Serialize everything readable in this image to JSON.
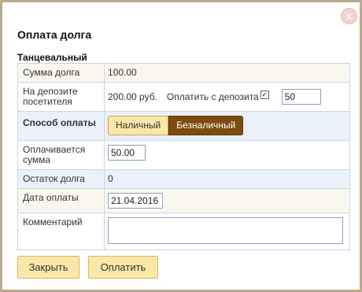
{
  "dialog": {
    "close_glyph": "x",
    "title": "Оплата долга",
    "subtitle": "Танцевальный"
  },
  "form": {
    "debt_amount": {
      "label": "Сумма долга",
      "value": "100.00"
    },
    "deposit": {
      "label": "На депозите посетителя",
      "value": "200.00 руб.",
      "pay_from_deposit_label": "Оплатить с депозита",
      "pay_from_deposit_checked": true,
      "deposit_amount": "50"
    },
    "payment_method": {
      "label": "Способ оплаты",
      "options": [
        "Наличный",
        "Безналичный"
      ],
      "selected": "Безналичный"
    },
    "paid_amount": {
      "label": "Оплачивается сумма",
      "value": "50.00"
    },
    "remaining_debt": {
      "label": "Остаток долга",
      "value": "0"
    },
    "payment_date": {
      "label": "Дата оплаты",
      "value": "21.04.2016"
    },
    "comment": {
      "label": "Комментарий",
      "value": ""
    }
  },
  "buttons": {
    "close": "Закрыть",
    "pay": "Оплатить"
  },
  "colors": {
    "accent": "#fbe7a8",
    "selected_option": "#7c4c0f",
    "border": "#b9a98e"
  }
}
